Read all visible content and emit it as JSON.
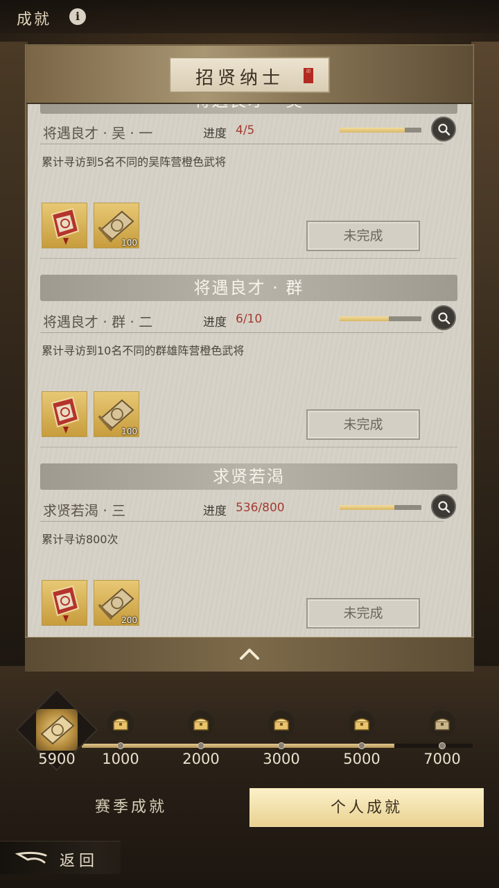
{
  "topbar": {
    "title": "成就",
    "info_icon": "i"
  },
  "panel": {
    "title": "招贤纳士",
    "seal_text": "印",
    "partial_section_title": "将遇良才 · 吴",
    "collapse_icon": "chevron-up-icon"
  },
  "tasks": [
    {
      "name": "将遇良才 · 吴 · 一",
      "progress_label": "进度",
      "progress_text": "4/5",
      "progress_fraction": 0.8,
      "description": "累计寻访到5名不同的吴阵营橙色武将",
      "rewards": [
        {
          "icon": "command-token-icon",
          "qty": ""
        },
        {
          "icon": "scroll-icon",
          "qty": "100"
        }
      ],
      "status": "未完成"
    },
    {
      "section_title": "将遇良才 · 群",
      "name": "将遇良才 · 群 · 二",
      "progress_label": "进度",
      "progress_text": "6/10",
      "progress_fraction": 0.6,
      "description": "累计寻访到10名不同的群雄阵营橙色武将",
      "rewards": [
        {
          "icon": "command-token-icon",
          "qty": ""
        },
        {
          "icon": "scroll-icon",
          "qty": "100"
        }
      ],
      "status": "未完成"
    },
    {
      "section_title": "求贤若渴",
      "name": "求贤若渴 · 三",
      "progress_label": "进度",
      "progress_text": "536/800",
      "progress_fraction": 0.67,
      "description": "累计寻访800次",
      "rewards": [
        {
          "icon": "command-token-icon",
          "qty": ""
        },
        {
          "icon": "scroll-icon",
          "qty": "200"
        }
      ],
      "status": "未完成"
    }
  ],
  "milestones": {
    "current_value": "5900",
    "track_progress_fraction": 0.8,
    "points": [
      {
        "value": "1000",
        "icon": "chest-icon"
      },
      {
        "value": "2000",
        "icon": "chest-icon"
      },
      {
        "value": "3000",
        "icon": "chest-icon"
      },
      {
        "value": "5000",
        "icon": "chest-icon"
      },
      {
        "value": "7000",
        "icon": "chest-icon"
      }
    ]
  },
  "tabs": {
    "season": "赛季成就",
    "personal": "个人成就",
    "active": "personal"
  },
  "back": {
    "label": "返回"
  },
  "colors": {
    "accent_gold": "#e9d291",
    "progress_red": "#a33b33",
    "panel_paper": "#d6d1c6"
  }
}
